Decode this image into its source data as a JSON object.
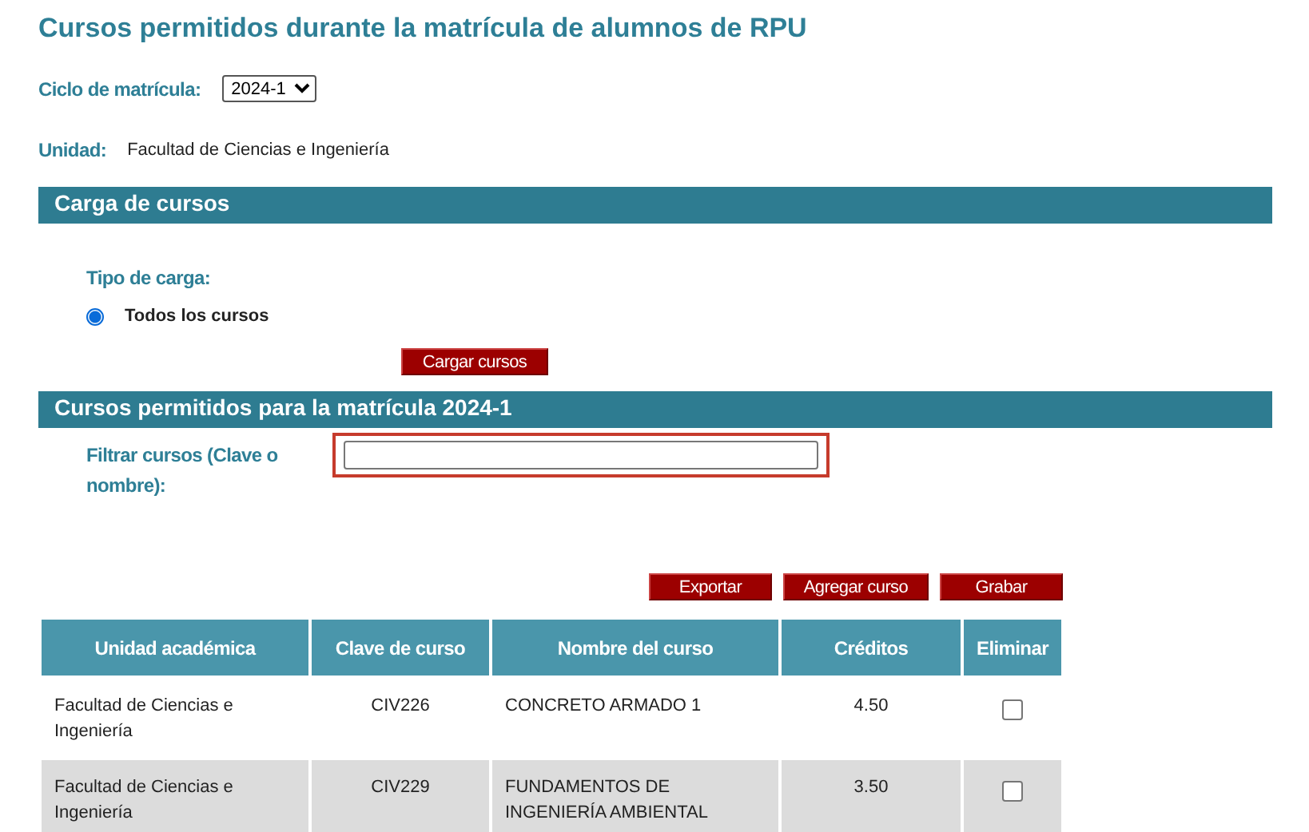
{
  "title": "Cursos permitidos durante la matrícula de alumnos de RPU",
  "cycle": {
    "label": "Ciclo de matrícula:",
    "value": "2024-1"
  },
  "unit": {
    "label": "Unidad:",
    "value": "Facultad de Ciencias e Ingeniería"
  },
  "load_section": {
    "heading": "Carga de cursos",
    "type_label": "Tipo de carga:",
    "options": [
      {
        "label": "Todos los cursos",
        "selected": true
      }
    ],
    "button": "Cargar cursos"
  },
  "courses_section": {
    "heading": "Cursos permitidos para la matrícula 2024-1",
    "filter_label": "Filtrar cursos (Clave o nombre):",
    "buttons": [
      "Exportar",
      "Agregar curso",
      "Grabar"
    ]
  },
  "table": {
    "columns": [
      "Unidad académica",
      "Clave de curso",
      "Nombre del curso",
      "Créditos",
      "Eliminar"
    ],
    "rows": [
      {
        "unit": "Facultad de Ciencias e Ingeniería",
        "code": "CIV226",
        "name": "CONCRETO ARMADO 1",
        "credits": "4.50",
        "checked": false
      },
      {
        "unit": "Facultad de Ciencias e Ingeniería",
        "code": "CIV229",
        "name": "FUNDAMENTOS DE INGENIERÍA AMBIENTAL",
        "credits": "3.50",
        "checked": false
      }
    ]
  }
}
